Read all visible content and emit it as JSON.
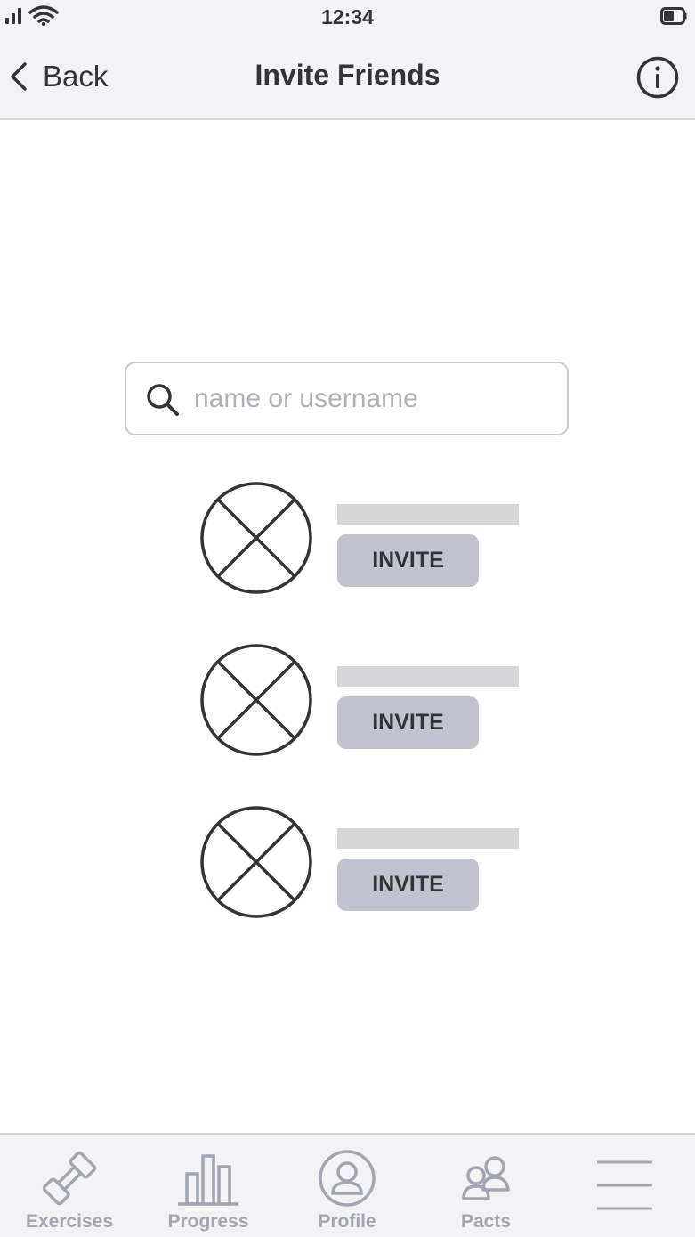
{
  "status_bar": {
    "time": "12:34"
  },
  "nav": {
    "back_label": "Back",
    "title": "Invite Friends"
  },
  "search": {
    "placeholder": "name or username",
    "value": ""
  },
  "friends": [
    {
      "invite_label": "INVITE"
    },
    {
      "invite_label": "INVITE"
    },
    {
      "invite_label": "INVITE"
    }
  ],
  "tabs": [
    {
      "label": "Exercises",
      "icon": "dumbbell-icon"
    },
    {
      "label": "Progress",
      "icon": "bar-chart-icon"
    },
    {
      "label": "Profile",
      "icon": "user-circle-icon"
    },
    {
      "label": "Pacts",
      "icon": "users-icon"
    },
    {
      "label": "",
      "icon": "menu-icon"
    }
  ],
  "colors": {
    "bar_background": "#f3f3f5",
    "invite_button": "#c1c4cf",
    "placeholder_bar": "#d6d6d8",
    "tab_inactive": "#a3a6b2",
    "text_dark": "#333338"
  }
}
